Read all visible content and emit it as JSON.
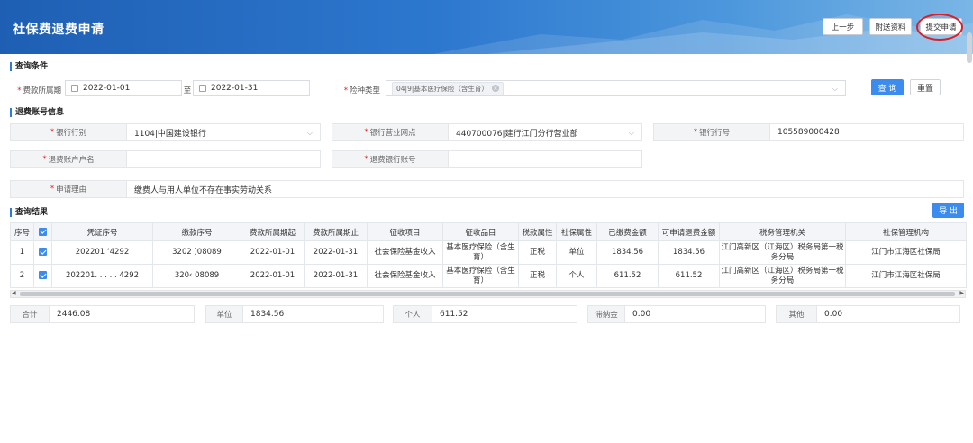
{
  "header": {
    "title": "社保费退费申请",
    "buttons": {
      "prev": "上一步",
      "attach": "附送资料",
      "submit": "提交申请"
    }
  },
  "query": {
    "section_title": "查询条件",
    "period_label": "费款所属期",
    "period_start": "2022-01-01",
    "period_sep": "至",
    "period_end": "2022-01-31",
    "insurance_label": "险种类型",
    "insurance_tag": "04|9|基本医疗保险（含生育）",
    "query_button": "查 询",
    "reset_button": "重置"
  },
  "account": {
    "section_title": "退费账号信息",
    "bank_type_label": "银行行别",
    "bank_type_value": "1104|中国建设银行",
    "bank_branch_label": "银行营业网点",
    "bank_branch_value": "440700076|建行江门分行营业部",
    "bank_no_label": "银行行号",
    "bank_no_value": "105589000428",
    "account_name_label": "退费账户户名",
    "account_name_value": "",
    "account_no_label": "退费银行账号",
    "account_no_value": "",
    "reason_label": "申请理由",
    "reason_value": "缴费人与用人单位不存在事实劳动关系"
  },
  "results": {
    "section_title": "查询结果",
    "export_button": "导 出",
    "columns": [
      "序号",
      "",
      "凭证序号",
      "缴款序号",
      "费款所属期起",
      "费款所属期止",
      "征收项目",
      "征收品目",
      "税款属性",
      "社保属性",
      "已缴费金额",
      "可申请退费金额",
      "税务管理机关",
      "社保管理机构"
    ],
    "rows": [
      {
        "no": "1",
        "voucher": "202201 ‘4292",
        "payment": "3202 )08089",
        "start": "2022-01-01",
        "end": "2022-01-31",
        "item": "社会保险基金收入",
        "subitem": "基本医疗保险（含生育）",
        "tax_attr": "正税",
        "si_attr": "单位",
        "paid": "1834.56",
        "refundable": "1834.56",
        "tax_office": "江门高新区（江海区）税务局第一税务分局",
        "si_office": "江门市江海区社保局"
      },
      {
        "no": "2",
        "voucher": "202201. . . . . 4292",
        "payment": "320‹ 08089",
        "start": "2022-01-01",
        "end": "2022-01-31",
        "item": "社会保险基金收入",
        "subitem": "基本医疗保险（含生育）",
        "tax_attr": "正税",
        "si_attr": "个人",
        "paid": "611.52",
        "refundable": "611.52",
        "tax_office": "江门高新区（江海区）税务局第一税务分局",
        "si_office": "江门市江海区社保局"
      }
    ]
  },
  "totals": {
    "total_label": "合计",
    "total_value": "2446.08",
    "unit_label": "单位",
    "unit_value": "1834.56",
    "personal_label": "个人",
    "personal_value": "611.52",
    "late_label": "滞纳金",
    "late_value": "0.00",
    "other_label": "其他",
    "other_value": "0.00"
  },
  "colors": {
    "header": "#2d78cf",
    "primary": "#3b8cee",
    "highlight_circle": "#d8202a"
  }
}
